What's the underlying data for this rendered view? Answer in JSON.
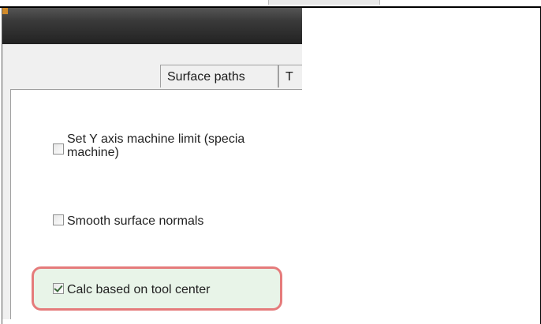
{
  "dialog": {
    "tabs": [
      {
        "label": "Surface paths"
      },
      {
        "label": "T"
      }
    ],
    "options": [
      {
        "label_line1": "Set Y axis machine limit (specia",
        "label_line2": "machine)",
        "checked": false
      },
      {
        "label": "Smooth surface normals",
        "checked": false
      },
      {
        "label": "Calc based on tool center",
        "checked": true,
        "highlighted": true
      }
    ],
    "colors": {
      "title_bar": "#2b2b2b",
      "highlight_border": "#e57b7b",
      "highlight_fill": "#e8f4e8"
    }
  }
}
